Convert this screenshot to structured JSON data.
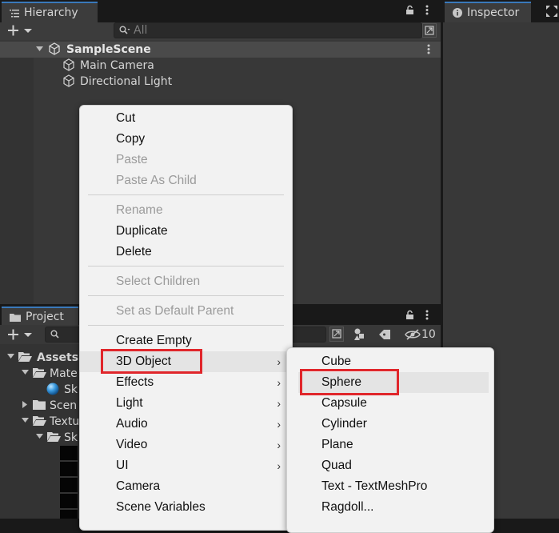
{
  "hierarchy": {
    "tab_label": "Hierarchy",
    "search_placeholder": "All",
    "scene_name": "SampleScene",
    "items": [
      {
        "label": "Main Camera"
      },
      {
        "label": "Directional Light"
      }
    ]
  },
  "inspector": {
    "tab_label": "Inspector"
  },
  "project": {
    "tab_label": "Project",
    "hidden_count": "10",
    "tree": [
      {
        "label": "Assets"
      },
      {
        "label": "Mate"
      },
      {
        "label": "Sk"
      },
      {
        "label": "Scen"
      },
      {
        "label": "Textu"
      },
      {
        "label": "Sk"
      }
    ]
  },
  "context_menu": {
    "items": [
      {
        "label": "Cut",
        "enabled": true
      },
      {
        "label": "Copy",
        "enabled": true
      },
      {
        "label": "Paste",
        "enabled": false
      },
      {
        "label": "Paste As Child",
        "enabled": false
      },
      {
        "label": "Rename",
        "enabled": false
      },
      {
        "label": "Duplicate",
        "enabled": true
      },
      {
        "label": "Delete",
        "enabled": true
      },
      {
        "label": "Select Children",
        "enabled": false
      },
      {
        "label": "Set as Default Parent",
        "enabled": false
      },
      {
        "label": "Create Empty",
        "enabled": true
      },
      {
        "label": "3D Object",
        "enabled": true,
        "submenu": true
      },
      {
        "label": "Effects",
        "enabled": true,
        "submenu": true
      },
      {
        "label": "Light",
        "enabled": true,
        "submenu": true
      },
      {
        "label": "Audio",
        "enabled": true,
        "submenu": true
      },
      {
        "label": "Video",
        "enabled": true,
        "submenu": true
      },
      {
        "label": "UI",
        "enabled": true,
        "submenu": true
      },
      {
        "label": "Camera",
        "enabled": true
      },
      {
        "label": "Scene Variables",
        "enabled": true
      }
    ]
  },
  "submenu_3d": {
    "items": [
      {
        "label": "Cube"
      },
      {
        "label": "Sphere"
      },
      {
        "label": "Capsule"
      },
      {
        "label": "Cylinder"
      },
      {
        "label": "Plane"
      },
      {
        "label": "Quad"
      },
      {
        "label": "Text - TextMeshPro"
      },
      {
        "label": "Ragdoll..."
      }
    ]
  },
  "colors": {
    "highlight_box": "#e0262b",
    "tab_accent": "#3a79bb"
  }
}
